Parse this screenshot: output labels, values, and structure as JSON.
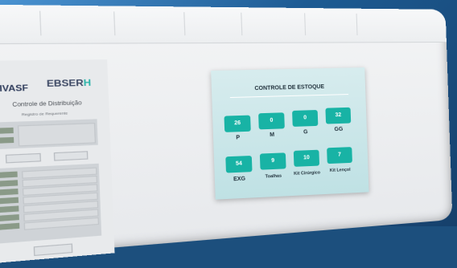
{
  "form": {
    "logo_left": "UNIVASF",
    "logo_right_main": "EBSER",
    "logo_right_accent": "H",
    "title": "Controle de Distribuição",
    "subtitle": "Registro de Requerente",
    "buttons": [
      "",
      "",
      ""
    ]
  },
  "stock": {
    "title": "CONTROLE DE ESTOQUE",
    "items": [
      {
        "label": "P",
        "value": "26"
      },
      {
        "label": "M",
        "value": "0"
      },
      {
        "label": "G",
        "value": "0"
      },
      {
        "label": "GG",
        "value": "32"
      },
      {
        "label": "EXG",
        "value": "54"
      },
      {
        "label": "Toalhas",
        "value": "9"
      },
      {
        "label": "Kit Cirúrgico",
        "value": "10"
      },
      {
        "label": "Kit Lençol",
        "value": "7"
      }
    ]
  }
}
